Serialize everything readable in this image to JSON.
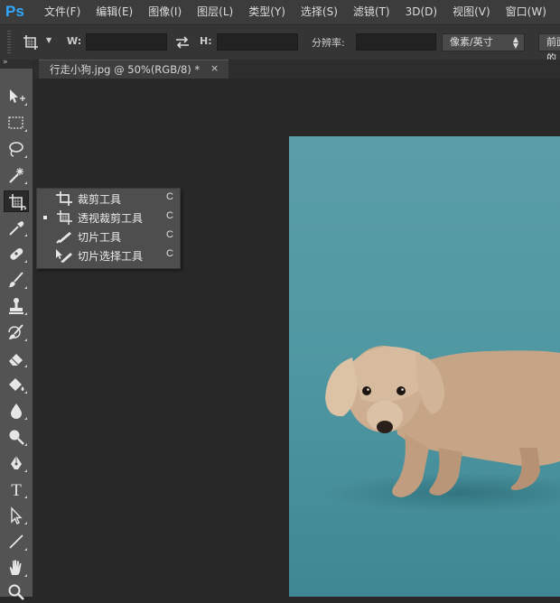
{
  "app": {
    "logo": "Ps"
  },
  "menubar": {
    "items": [
      "文件(F)",
      "编辑(E)",
      "图像(I)",
      "图层(L)",
      "类型(Y)",
      "选择(S)",
      "滤镜(T)",
      "3D(D)",
      "视图(V)",
      "窗口(W)"
    ]
  },
  "options": {
    "width_label": "W:",
    "height_label": "H:",
    "resolution_label": "分辨率:",
    "unit_value": "像素/英寸",
    "front_button": "前面的"
  },
  "document": {
    "tab_title": "行走小狗.jpg @ 50%(RGB/8) *",
    "close_glyph": "×"
  },
  "flyout": {
    "items": [
      {
        "label": "裁剪工具",
        "shortcut": "C",
        "icon": "crop-icon",
        "selected": false
      },
      {
        "label": "透视裁剪工具",
        "shortcut": "C",
        "icon": "perspective-crop-icon",
        "selected": true
      },
      {
        "label": "切片工具",
        "shortcut": "C",
        "icon": "slice-icon",
        "selected": false
      },
      {
        "label": "切片选择工具",
        "shortcut": "C",
        "icon": "slice-select-icon",
        "selected": false
      }
    ]
  },
  "toolbar": {
    "tools": [
      "move-tool-icon",
      "marquee-tool-icon",
      "lasso-tool-icon",
      "magic-wand-icon",
      "perspective-crop-icon",
      "eyedropper-icon",
      "healing-brush-icon",
      "brush-icon",
      "clone-stamp-icon",
      "history-brush-icon",
      "eraser-icon",
      "paint-bucket-icon",
      "blur-icon",
      "dodge-icon",
      "pen-icon",
      "type-tool-icon",
      "path-select-icon",
      "line-tool-icon",
      "hand-tool-icon",
      "zoom-tool-icon"
    ],
    "type_glyph": "T"
  },
  "colors": {
    "accent": "#31a8ff",
    "background": "#282828",
    "photo_bg": "#4f9aa6"
  }
}
